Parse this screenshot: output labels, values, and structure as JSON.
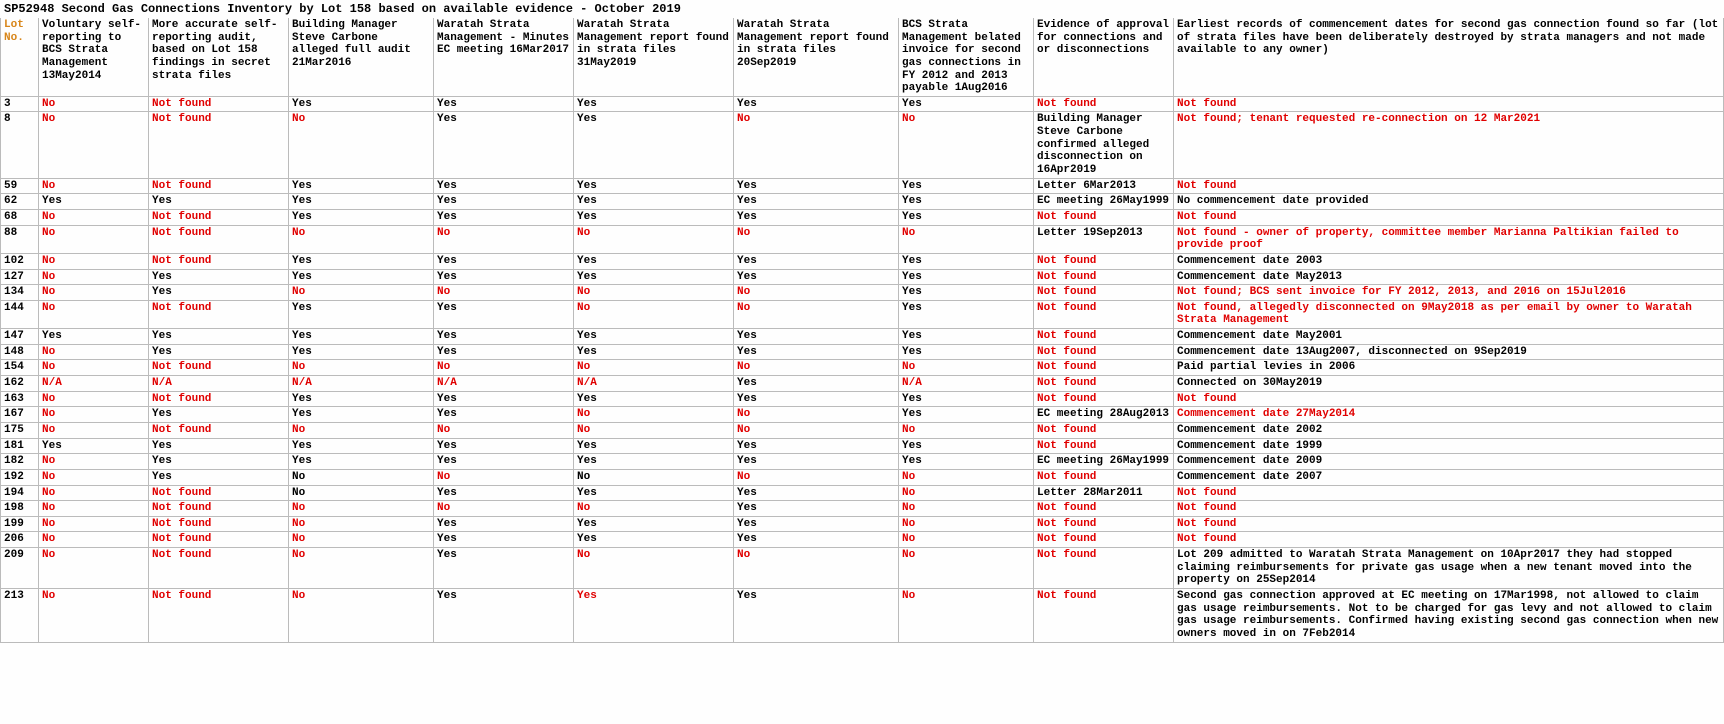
{
  "title": "SP52948 Second Gas Connections Inventory by Lot 158 based on available evidence - October 2019",
  "headers": [
    "Lot No.",
    "Voluntary self-reporting to BCS Strata Management 13May2014",
    "More accurate self-reporting audit, based on Lot 158 findings in secret strata files",
    "Building Manager Steve Carbone alleged full audit 21Mar2016",
    "Waratah Strata Management - Minutes EC meeting 16Mar2017",
    "Waratah Strata Management report found in strata files 31May2019",
    "Waratah Strata Management report found in strata files 20Sep2019",
    "BCS Strata Management belated invoice for second gas connections in FY 2012 and 2013 payable 1Aug2016",
    "Evidence of approval for connections and or disconnections",
    "Earliest records of commencement dates for second gas connection found so far (lot of strata files have been deliberately destroyed by strata managers and not made available to any owner)"
  ],
  "rows": [
    {
      "lot": "3",
      "c": [
        [
          "No",
          1
        ],
        [
          "Not found",
          1
        ],
        [
          "Yes",
          0
        ],
        [
          "Yes",
          0
        ],
        [
          "Yes",
          0
        ],
        [
          "Yes",
          0
        ],
        [
          "Yes",
          0
        ],
        [
          "Not found",
          1
        ],
        [
          "Not found",
          1
        ]
      ]
    },
    {
      "lot": "8",
      "c": [
        [
          "No",
          1
        ],
        [
          "Not found",
          1
        ],
        [
          "No",
          1
        ],
        [
          "Yes",
          0
        ],
        [
          "Yes",
          0
        ],
        [
          "No",
          1
        ],
        [
          "No",
          1
        ],
        [
          "Building Manager Steve Carbone confirmed alleged disconnection on 16Apr2019",
          0
        ],
        [
          "Not found; tenant requested re-connection on 12 Mar2021",
          1
        ]
      ]
    },
    {
      "lot": "59",
      "c": [
        [
          "No",
          1
        ],
        [
          "Not found",
          1
        ],
        [
          "Yes",
          0
        ],
        [
          "Yes",
          0
        ],
        [
          "Yes",
          0
        ],
        [
          "Yes",
          0
        ],
        [
          "Yes",
          0
        ],
        [
          "Letter 6Mar2013",
          0
        ],
        [
          "Not found",
          1
        ]
      ]
    },
    {
      "lot": "62",
      "c": [
        [
          "Yes",
          0
        ],
        [
          "Yes",
          0
        ],
        [
          "Yes",
          0
        ],
        [
          "Yes",
          0
        ],
        [
          "Yes",
          0
        ],
        [
          "Yes",
          0
        ],
        [
          "Yes",
          0
        ],
        [
          "EC meeting 26May1999",
          0
        ],
        [
          "No commencement date provided",
          0
        ]
      ]
    },
    {
      "lot": "68",
      "c": [
        [
          "No",
          1
        ],
        [
          "Not found",
          1
        ],
        [
          "Yes",
          0
        ],
        [
          "Yes",
          0
        ],
        [
          "Yes",
          0
        ],
        [
          "Yes",
          0
        ],
        [
          "Yes",
          0
        ],
        [
          "Not found",
          1
        ],
        [
          "Not found",
          1
        ]
      ]
    },
    {
      "lot": "88",
      "c": [
        [
          "No",
          1
        ],
        [
          "Not found",
          1
        ],
        [
          "No",
          1
        ],
        [
          "No",
          1
        ],
        [
          "No",
          1
        ],
        [
          "No",
          1
        ],
        [
          "No",
          1
        ],
        [
          "Letter 19Sep2013",
          0
        ],
        [
          "Not found - owner of property, committee member Marianna Paltikian failed to provide proof",
          1
        ]
      ]
    },
    {
      "lot": "102",
      "c": [
        [
          "No",
          1
        ],
        [
          "Not found",
          1
        ],
        [
          "Yes",
          0
        ],
        [
          "Yes",
          0
        ],
        [
          "Yes",
          0
        ],
        [
          "Yes",
          0
        ],
        [
          "Yes",
          0
        ],
        [
          "Not found",
          1
        ],
        [
          "Commencement date 2003",
          0
        ]
      ]
    },
    {
      "lot": "127",
      "c": [
        [
          "No",
          1
        ],
        [
          "Yes",
          0
        ],
        [
          "Yes",
          0
        ],
        [
          "Yes",
          0
        ],
        [
          "Yes",
          0
        ],
        [
          "Yes",
          0
        ],
        [
          "Yes",
          0
        ],
        [
          "Not found",
          1
        ],
        [
          "Commencement date May2013",
          0
        ]
      ]
    },
    {
      "lot": "134",
      "c": [
        [
          "No",
          1
        ],
        [
          "Yes",
          0
        ],
        [
          "No",
          1
        ],
        [
          "No",
          1
        ],
        [
          "No",
          1
        ],
        [
          "No",
          1
        ],
        [
          "Yes",
          0
        ],
        [
          "Not found",
          1
        ],
        [
          "Not found; BCS sent invoice for FY 2012, 2013,  and 2016 on 15Jul2016",
          1
        ]
      ]
    },
    {
      "lot": "144",
      "c": [
        [
          "No",
          1
        ],
        [
          "Not found",
          1
        ],
        [
          "Yes",
          0
        ],
        [
          "Yes",
          0
        ],
        [
          "No",
          1
        ],
        [
          "No",
          1
        ],
        [
          "Yes",
          0
        ],
        [
          "Not found",
          1
        ],
        [
          "Not found, allegedly disconnected on 9May2018 as per email by owner to Waratah Strata Management",
          1
        ]
      ]
    },
    {
      "lot": "147",
      "c": [
        [
          "Yes",
          0
        ],
        [
          "Yes",
          0
        ],
        [
          "Yes",
          0
        ],
        [
          "Yes",
          0
        ],
        [
          "Yes",
          0
        ],
        [
          "Yes",
          0
        ],
        [
          "Yes",
          0
        ],
        [
          "Not found",
          1
        ],
        [
          "Commencement date May2001",
          0
        ]
      ]
    },
    {
      "lot": "148",
      "c": [
        [
          "No",
          1
        ],
        [
          "Yes",
          0
        ],
        [
          "Yes",
          0
        ],
        [
          "Yes",
          0
        ],
        [
          "Yes",
          0
        ],
        [
          "Yes",
          0
        ],
        [
          "Yes",
          0
        ],
        [
          "Not found",
          1
        ],
        [
          "Commencement date 13Aug2007, disconnected on 9Sep2019",
          0
        ]
      ]
    },
    {
      "lot": "154",
      "c": [
        [
          "No",
          1
        ],
        [
          "Not found",
          1
        ],
        [
          "No",
          1
        ],
        [
          "No",
          1
        ],
        [
          "No",
          1
        ],
        [
          "No",
          1
        ],
        [
          "No",
          1
        ],
        [
          "Not found",
          1
        ],
        [
          "Paid partial levies in 2006",
          0
        ]
      ]
    },
    {
      "lot": "162",
      "c": [
        [
          "N/A",
          1
        ],
        [
          "N/A",
          1
        ],
        [
          "N/A",
          1
        ],
        [
          "N/A",
          1
        ],
        [
          "N/A",
          1
        ],
        [
          "Yes",
          0
        ],
        [
          "N/A",
          1
        ],
        [
          "Not found",
          1
        ],
        [
          "Connected on 30May2019",
          0
        ]
      ]
    },
    {
      "lot": "163",
      "c": [
        [
          "No",
          1
        ],
        [
          "Not found",
          1
        ],
        [
          "Yes",
          0
        ],
        [
          "Yes",
          0
        ],
        [
          "Yes",
          0
        ],
        [
          "Yes",
          0
        ],
        [
          "Yes",
          0
        ],
        [
          "Not found",
          1
        ],
        [
          "Not found",
          1
        ]
      ]
    },
    {
      "lot": "167",
      "c": [
        [
          "No",
          1
        ],
        [
          "Yes",
          0
        ],
        [
          "Yes",
          0
        ],
        [
          "Yes",
          0
        ],
        [
          "No",
          1
        ],
        [
          "No",
          1
        ],
        [
          "Yes",
          0
        ],
        [
          "EC meeting 28Aug2013",
          0
        ],
        [
          "Commencement date 27May2014",
          1
        ]
      ]
    },
    {
      "lot": "175",
      "c": [
        [
          "No",
          1
        ],
        [
          "Not found",
          1
        ],
        [
          "No",
          1
        ],
        [
          "No",
          1
        ],
        [
          "No",
          1
        ],
        [
          "No",
          1
        ],
        [
          "No",
          1
        ],
        [
          "Not found",
          1
        ],
        [
          "Commencement date 2002",
          0
        ]
      ]
    },
    {
      "lot": "181",
      "c": [
        [
          "Yes",
          0
        ],
        [
          "Yes",
          0
        ],
        [
          "Yes",
          0
        ],
        [
          "Yes",
          0
        ],
        [
          "Yes",
          0
        ],
        [
          "Yes",
          0
        ],
        [
          "Yes",
          0
        ],
        [
          "Not found",
          1
        ],
        [
          "Commencement date 1999",
          0
        ]
      ]
    },
    {
      "lot": "182",
      "c": [
        [
          "No",
          1
        ],
        [
          "Yes",
          0
        ],
        [
          "Yes",
          0
        ],
        [
          "Yes",
          0
        ],
        [
          "Yes",
          0
        ],
        [
          "Yes",
          0
        ],
        [
          "Yes",
          0
        ],
        [
          "EC meeting 26May1999",
          0
        ],
        [
          "Commencement date 2009",
          0
        ]
      ]
    },
    {
      "lot": "192",
      "c": [
        [
          "No",
          1
        ],
        [
          "Yes",
          0
        ],
        [
          "No",
          0
        ],
        [
          "No",
          1
        ],
        [
          "No",
          0
        ],
        [
          "No",
          1
        ],
        [
          "No",
          1
        ],
        [
          "Not found",
          1
        ],
        [
          "Commencement date 2007",
          0
        ]
      ]
    },
    {
      "lot": "194",
      "c": [
        [
          "No",
          1
        ],
        [
          "Not found",
          1
        ],
        [
          "No",
          0
        ],
        [
          "Yes",
          0
        ],
        [
          "Yes",
          0
        ],
        [
          "Yes",
          0
        ],
        [
          "No",
          1
        ],
        [
          "Letter 28Mar2011",
          0
        ],
        [
          "Not found",
          1
        ]
      ]
    },
    {
      "lot": "198",
      "c": [
        [
          "No",
          1
        ],
        [
          "Not found",
          1
        ],
        [
          "No",
          1
        ],
        [
          "No",
          1
        ],
        [
          "No",
          1
        ],
        [
          "Yes",
          0
        ],
        [
          "No",
          1
        ],
        [
          "Not found",
          1
        ],
        [
          "Not found",
          1
        ]
      ]
    },
    {
      "lot": "199",
      "c": [
        [
          "No",
          1
        ],
        [
          "Not found",
          1
        ],
        [
          "No",
          1
        ],
        [
          "Yes",
          0
        ],
        [
          "Yes",
          0
        ],
        [
          "Yes",
          0
        ],
        [
          "No",
          1
        ],
        [
          "Not found",
          1
        ],
        [
          "Not found",
          1
        ]
      ]
    },
    {
      "lot": "206",
      "c": [
        [
          "No",
          1
        ],
        [
          "Not found",
          1
        ],
        [
          "No",
          1
        ],
        [
          "Yes",
          0
        ],
        [
          "Yes",
          0
        ],
        [
          "Yes",
          0
        ],
        [
          "No",
          1
        ],
        [
          "Not found",
          1
        ],
        [
          "Not found",
          1
        ]
      ]
    },
    {
      "lot": "209",
      "c": [
        [
          "No",
          1
        ],
        [
          "Not found",
          1
        ],
        [
          "No",
          1
        ],
        [
          "Yes",
          0
        ],
        [
          "No",
          1
        ],
        [
          "No",
          1
        ],
        [
          "No",
          1
        ],
        [
          "Not found",
          1
        ],
        [
          "Lot 209 admitted to Waratah Strata Management on 10Apr2017 they had stopped claiming reimbursements for private gas usage when a new tenant moved into the property on 25Sep2014",
          0
        ]
      ]
    },
    {
      "lot": "213",
      "c": [
        [
          "No",
          1
        ],
        [
          "Not found",
          1
        ],
        [
          "No",
          1
        ],
        [
          "Yes",
          0
        ],
        [
          "Yes",
          1
        ],
        [
          "Yes",
          0
        ],
        [
          "No",
          1
        ],
        [
          "Not found",
          1
        ],
        [
          "Second gas connection approved at EC meeting on 17Mar1998, not allowed to claim gas usage reimbursements. Not to be charged for gas levy and not allowed to claim gas usage reimbursements. Confirmed having existing second gas connection when new owners moved in on 7Feb2014",
          0
        ]
      ]
    }
  ]
}
